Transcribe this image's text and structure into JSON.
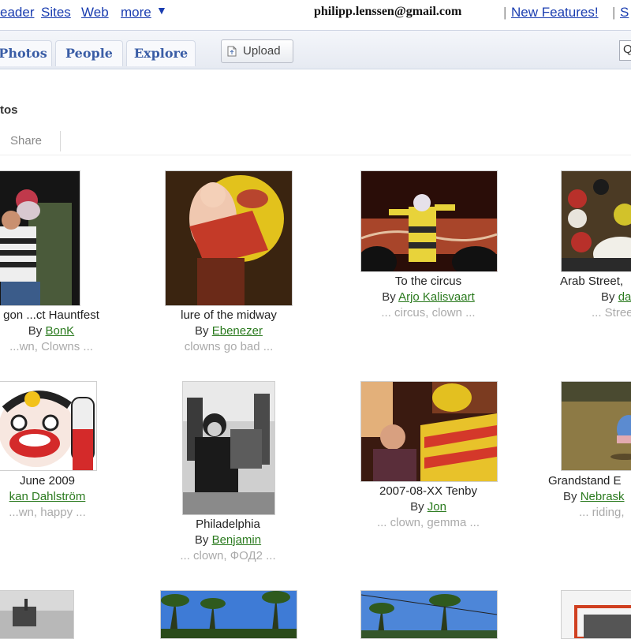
{
  "topbar": {
    "links": [
      "eader",
      "Sites",
      "Web"
    ],
    "more": "more",
    "more_caret": "▼",
    "email": "philipp.lenssen@gmail.com",
    "separator": "|",
    "new_features": "New Features!",
    "trailing": "S"
  },
  "tabs": [
    "Photos",
    "People",
    "Explore"
  ],
  "upload_label": "Upload",
  "search_placeholder": "Q",
  "heading": "tos",
  "share_label": "Share",
  "photos": [
    {
      "title": "gon ...ct Hauntfest",
      "by": "By",
      "author": "BonK",
      "tags": "...wn, Clowns ..."
    },
    {
      "title": "lure of the midway",
      "by": "By",
      "author": "Ebenezer",
      "tags": "clowns go bad ..."
    },
    {
      "title": "To the circus",
      "by": "By",
      "author": "Arjo Kalisvaart",
      "tags": "... circus, clown ..."
    },
    {
      "title": "Arab Street,",
      "by": "By",
      "author": "da",
      "tags": "... Street,"
    },
    {
      "title": "June 2009",
      "by": "",
      "author": "kan Dahlström",
      "tags": "...wn, happy ..."
    },
    {
      "title": "Philadelphia",
      "by": "By",
      "author": "Benjamin",
      "tags": "... clown, ФОД2 ..."
    },
    {
      "title": "2007-08-XX Tenby",
      "by": "By",
      "author": "Jon",
      "tags": "... clown, gemma ..."
    },
    {
      "title": "Grandstand E",
      "by": "By",
      "author": "Nebrask",
      "tags": "... riding,"
    }
  ]
}
